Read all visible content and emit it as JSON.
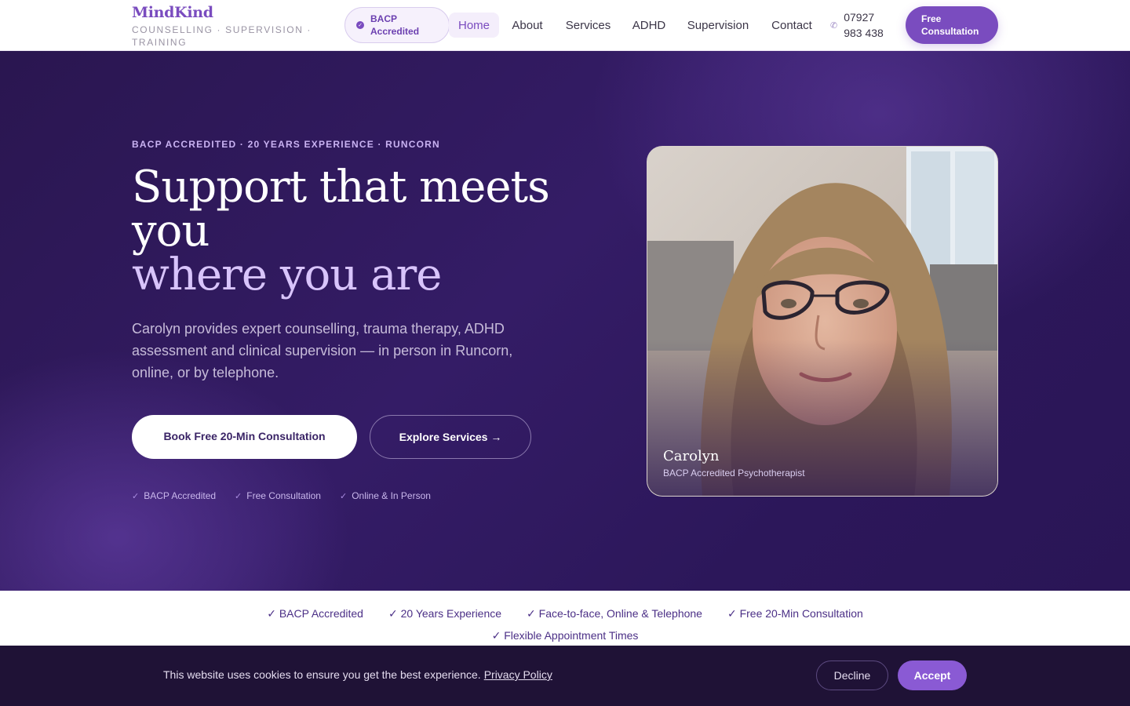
{
  "header": {
    "brand_name": "MindKind",
    "brand_tagline": "COUNSELLING · SUPERVISION · TRAINING",
    "badge": "BACP Accredited",
    "nav": [
      "Home",
      "About",
      "Services",
      "ADHD",
      "Supervision",
      "Contact"
    ],
    "active_nav": "Home",
    "phone": "07927 983 438",
    "cta": "Free Consultation"
  },
  "hero": {
    "eyebrow": "BACP ACCREDITED · 20 YEARS EXPERIENCE · RUNCORN",
    "heading_line1": "Support that meets",
    "heading_line2": "you",
    "heading_line3": "where you are",
    "lead": "Carolyn provides expert counselling, trauma therapy, ADHD assessment and clinical supervision — in person in Runcorn, online, or by telephone.",
    "primary_button": "Book Free 20-Min Consultation",
    "secondary_button": "Explore Services →",
    "checks": [
      "BACP Accredited",
      "Free Consultation",
      "Online & In Person"
    ],
    "photo_caption_name": "Carolyn",
    "photo_caption_role": "BACP Accredited Psychotherapist"
  },
  "strip": {
    "items": [
      "✓ BACP Accredited",
      "✓ 20 Years Experience",
      "✓ Face-to-face, Online & Telephone",
      "✓ Free 20-Min Consultation",
      "✓ Flexible Appointment Times"
    ]
  },
  "cookie": {
    "text": "This website uses cookies to ensure you get the best experience.",
    "policy_link": "Privacy Policy",
    "decline": "Decline",
    "accept": "Accept"
  },
  "colors": {
    "brand": "#7a4cbf",
    "hero_bg": "#2e1a5c",
    "heading_accent": "#d8c4fb",
    "cookie_bg": "#1f1236",
    "accept": "#8a5ad4"
  },
  "icons": {
    "badge": "check-circle-icon",
    "phone": "phone-icon",
    "check": "check-icon",
    "arrow": "arrow-right-icon"
  }
}
